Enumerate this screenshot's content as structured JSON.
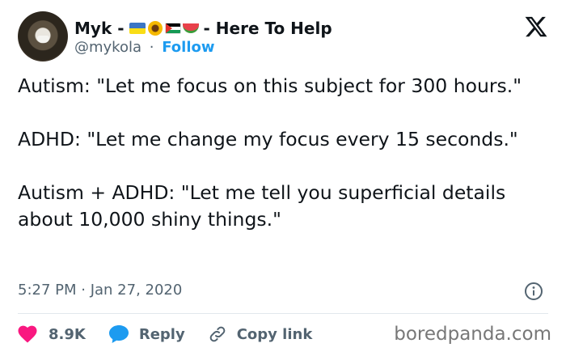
{
  "tweet": {
    "author_name": "Myk -",
    "author_suffix": "- Here To Help",
    "handle": "@mykola",
    "dot": "·",
    "follow_label": "Follow",
    "paragraphs": [
      "Autism: \"Let me focus on this subject for 300 hours.\"",
      "ADHD: \"Let me change my focus every 15 seconds.\"",
      "Autism + ADHD: \"Let me tell you superficial details about 10,000 shiny things.\""
    ],
    "timestamp": "5:27 PM · Jan 27, 2020"
  },
  "actions": {
    "like_count": "8.9K",
    "reply_label": "Reply",
    "copy_link_label": "Copy link"
  },
  "icons": {
    "logo": "x-logo-icon",
    "info": "info-icon",
    "like": "heart-icon",
    "reply": "speech-bubble-icon",
    "copy": "link-icon",
    "flags": [
      "ukraine-flag-icon",
      "sunflower-icon",
      "palestine-flag-icon",
      "watermelon-icon"
    ]
  },
  "colors": {
    "text": "#0f1419",
    "muted": "#536471",
    "accent": "#1d9bf0",
    "like": "#f91880"
  },
  "watermark": "boredpanda.com"
}
